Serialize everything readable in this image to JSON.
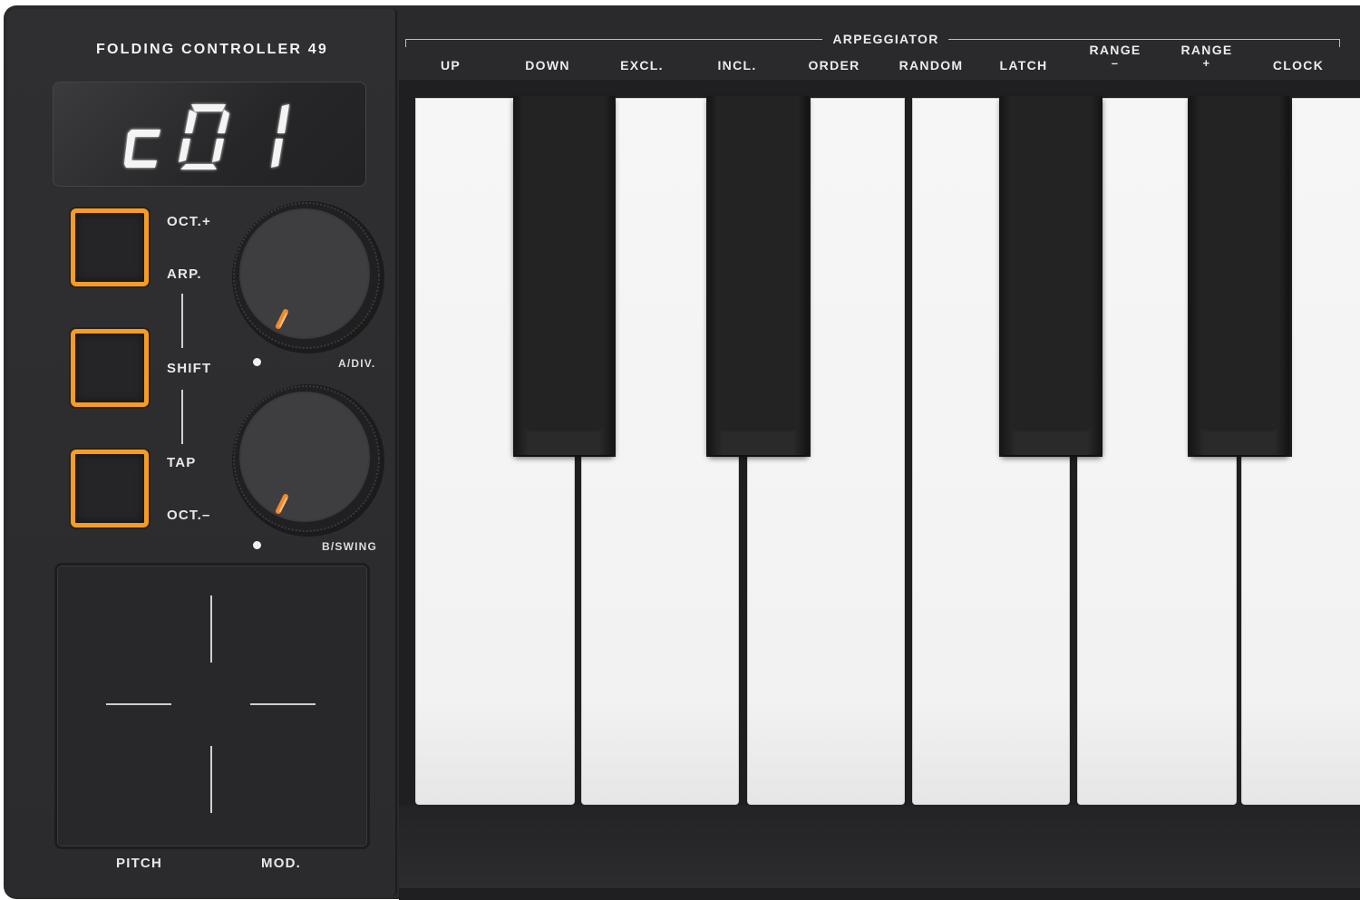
{
  "device": {
    "model_title": "FOLDING CONTROLLER 49",
    "display_value": "c01",
    "accent_color": "#f59c24"
  },
  "left_buttons": [
    {
      "label_top": "OCT.+",
      "label_bottom": "ARP."
    },
    {
      "label": "SHIFT"
    },
    {
      "label_top": "TAP",
      "label_bottom": "OCT.–"
    }
  ],
  "knobs": [
    {
      "label": "A/DIV."
    },
    {
      "label": "B/SWING"
    }
  ],
  "touchpad": {
    "labels": [
      "PITCH",
      "MOD."
    ]
  },
  "arpeggiator": {
    "title": "ARPEGGIATOR",
    "functions": [
      {
        "label": "UP"
      },
      {
        "label": "DOWN"
      },
      {
        "label": "EXCL."
      },
      {
        "label": "INCL."
      },
      {
        "label": "ORDER"
      },
      {
        "label": "RANDOM"
      },
      {
        "label": "LATCH"
      },
      {
        "label": "RANGE",
        "sub": "–"
      },
      {
        "label": "RANGE",
        "sub": "+"
      },
      {
        "label": "CLOCK"
      }
    ]
  },
  "keyboard": {
    "white_keys": 6,
    "black_keys": 4
  }
}
